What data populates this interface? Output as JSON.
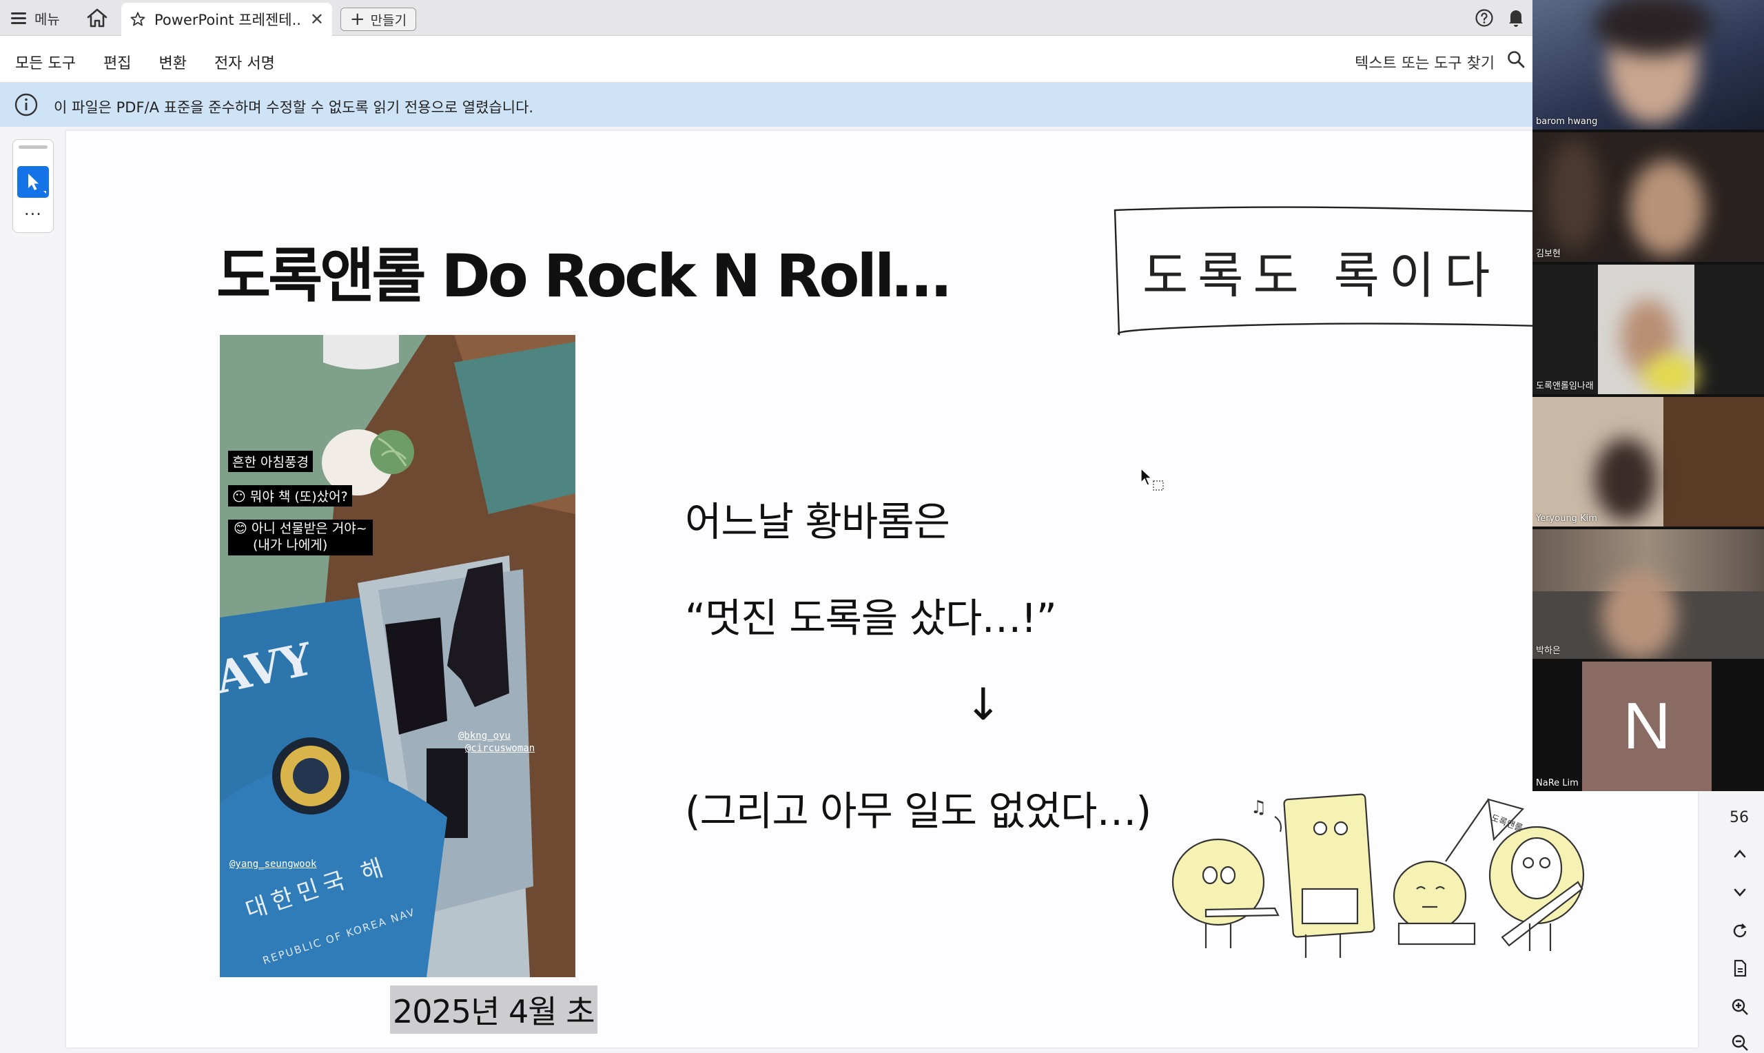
{
  "tabbar": {
    "menu_label": "메뉴",
    "tab_title": "PowerPoint 프레젠테...",
    "close_glyph": "✕",
    "new_tab_label": "만들기"
  },
  "toolbar": {
    "items": [
      "모든 도구",
      "편집",
      "변환",
      "전자 서명"
    ],
    "search_label": "텍스트 또는 도구 찾기"
  },
  "banner": {
    "message": "이 파일은 PDF/A 표준을 준수하며 수정할 수 없도록 읽기 전용으로 열렸습니다."
  },
  "slide": {
    "title": "도록앤롤 Do Rock N Roll…",
    "line1": "어느날 황바롬은",
    "line2": "“멋진 도록을 샀다…!”",
    "arrow": "↓",
    "line3": "(그리고 아무 일도 없었다…)",
    "date_caption": "2025년 4월 초",
    "handwriting": "도록도 록이다",
    "photo": {
      "sticker1": "흔한 아침풍경",
      "sticker2": "뭐야 책 (또)샀어?",
      "sticker3": "아니 선물받은 거야~",
      "sticker3b": "(내가 나에게)",
      "mention1": "@bkng_oyu",
      "mention2": "@circuswoman",
      "mention3": "@yang_seungwook",
      "book_title_ko": "대한민국 해",
      "book_sub": "REPUBLIC OF KOREA NAV",
      "book_cover_word": "AVY"
    },
    "band_flag_text": "도록앤롤"
  },
  "right_rail": {
    "page_number": "56"
  },
  "participants": [
    {
      "name": "barom hwang"
    },
    {
      "name": "김보현"
    },
    {
      "name": "도록앤롤임나래"
    },
    {
      "name": "Yeryoung Kim"
    },
    {
      "name": "박하은"
    },
    {
      "name": "NaRe Lim",
      "initial": "N"
    }
  ],
  "colors": {
    "accent": "#1473e6",
    "banner": "#cfe3f7",
    "caption_highlight": "#cdcdcf",
    "avatar_bg": "#8a6b63"
  }
}
